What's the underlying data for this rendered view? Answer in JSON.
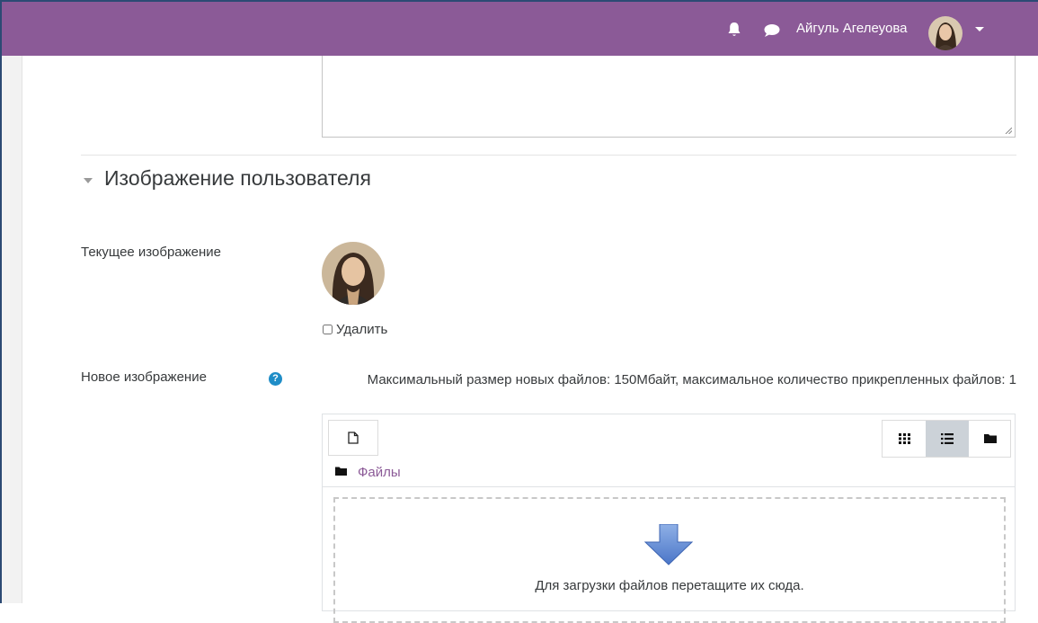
{
  "navbar": {
    "bg_color": "#8b5a97",
    "bell_icon": "bell-icon",
    "messages_icon": "chat-bubble-icon",
    "user_name": "Айгуль Агелеуова",
    "menu_icon": "caret-down-icon"
  },
  "section": {
    "title": "Изображение пользователя",
    "toggle_icon": "caret-down-icon"
  },
  "fields": {
    "current_image_label": "Текущее изображение",
    "delete_label": "Удалить",
    "delete_checked": false,
    "new_image_label": "Новое изображение",
    "help_glyph": "?",
    "help_icon": "question-circle-icon"
  },
  "filepicker": {
    "limits_text": "Максимальный размер новых файлов: 150Мбайт, максимальное количество прикрепленных файлов: 1",
    "add_icon": "file-add-icon",
    "view_icons": [
      "grid-view-icon",
      "list-view-icon",
      "folder-view-icon"
    ],
    "active_view": "list",
    "path_label": "Файлы",
    "drop_text": "Для загрузки файлов перетащите их сюда.",
    "link_color": "#8b5a97"
  }
}
